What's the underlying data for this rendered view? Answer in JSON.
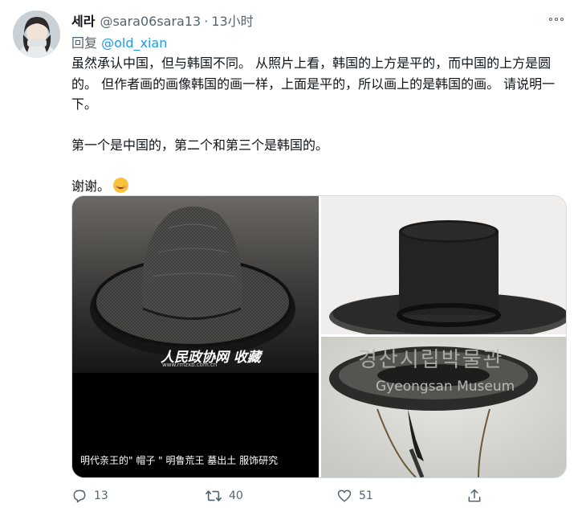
{
  "tweet": {
    "display_name": "세라",
    "handle": "@sara06sara13",
    "separator": "·",
    "time": "13小时",
    "reply_prefix": "回复",
    "reply_to": "@old_xian",
    "paragraphs": [
      "虽然承认中国，但与韩国不同。 从照片上看，韩国的上方是平的，而中国的上方是圆的。 但作者画的画像韩国的画一样，上面是平的，所以画上的是韩国的画。 请说明一下。",
      "第一个是中国的，第二个和第三个是韩国的。",
      "谢谢。"
    ],
    "emoji": "smiling-face-with-smiling-eyes-icon"
  },
  "media": {
    "left_caption": "明代亲王的\" 帽子 \" 明鲁荒王 墓出土 服饰研究",
    "left_watermark": "人民政协网 收藏",
    "left_watermark_url": "www.rmzxb.com.cn",
    "bottom_right_watermark_ko": "경산시립박물관",
    "bottom_right_watermark_en": "Gyeongsan Museum"
  },
  "actions": {
    "reply_count": "13",
    "retweet_count": "40",
    "like_count": "51"
  },
  "colors": {
    "accent": "#1d9bf0",
    "secondary_text": "#536471",
    "primary_text": "#0f1419",
    "border": "#cfd9de"
  }
}
